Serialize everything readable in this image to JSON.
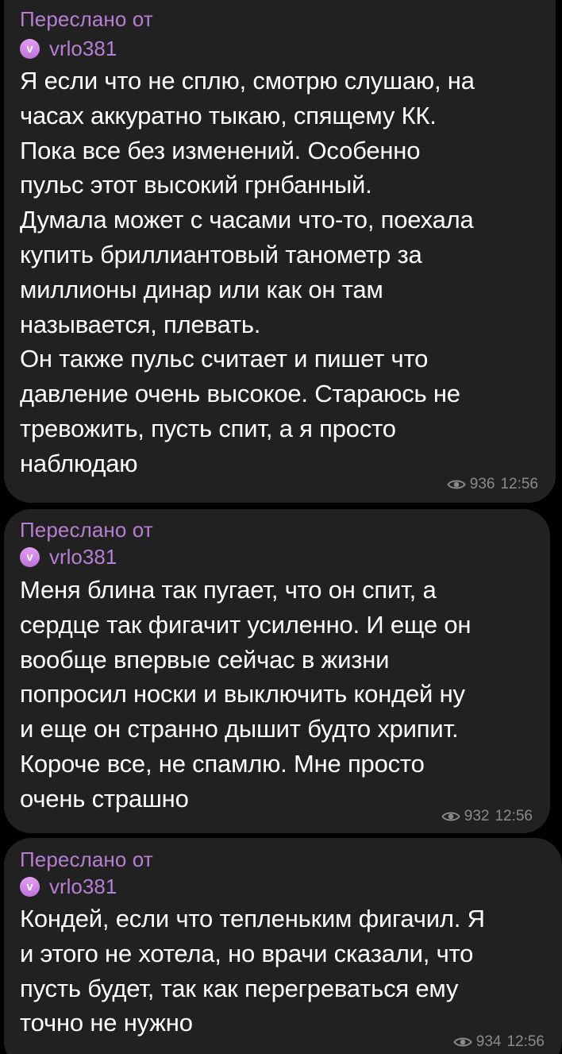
{
  "messages": [
    {
      "forwarded_label": "Переслано от",
      "author": "vrlo381",
      "avatar_letter": "v",
      "text": "Я если что не сплю, смотрю слушаю, на\nчасах аккуратно тыкаю, спящему КК.\nПока все без изменений. Особенно\nпульс этот высокий грнбанный.\nДумала может с часами что-то, поехала\nкупить бриллиантовый танометр за\nмиллионы динар или как он там\nназывается, плевать.\nОн также пульс считает и пишет что\nдавление очень высокое. Стараюсь не\nтревожить, пусть спит, а я просто\nнаблюдаю",
      "views": "936",
      "time": "12:56"
    },
    {
      "forwarded_label": "Переслано от",
      "author": "vrlo381",
      "avatar_letter": "v",
      "text": "Меня блина так пугает, что он спит, а\nсердце так фигачит усиленно. И еще он\nвообще впервые сейчас в жизни\nпопросил носки и выключить кондей ну\nи еще он странно дышит будто хрипит.\nКороче все, не спамлю. Мне просто\nочень страшно",
      "views": "932",
      "time": "12:56"
    },
    {
      "forwarded_label": "Переслано от",
      "author": "vrlo381",
      "avatar_letter": "v",
      "text": "Кондей, если что тепленьким фигачил. Я\nи этого не хотела, но врачи сказали, что\nпусть будет, так как перегреваться ему\nточно не нужно",
      "views": "934",
      "time": "12:56"
    }
  ],
  "colors": {
    "background": "#000000",
    "bubble": "#212121",
    "accent_purple": "#b77fd3",
    "text": "#ffffff",
    "meta": "#8a8a8a"
  },
  "icons": {
    "views": "eye-icon",
    "avatar": "avatar-circle"
  }
}
